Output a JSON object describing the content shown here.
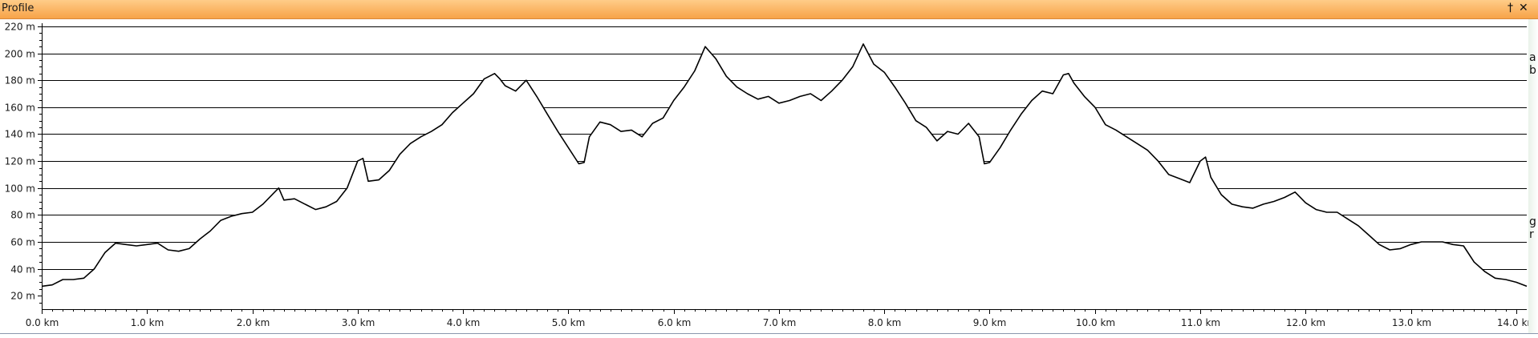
{
  "window": {
    "title": "Profile",
    "pin_icon": "pin-icon",
    "close_icon": "close-icon",
    "pin_glyph": "†",
    "close_glyph": "✕"
  },
  "right_strip_text": [
    "a",
    "b",
    "g",
    "r"
  ],
  "chart_data": {
    "type": "area",
    "xlabel": "",
    "ylabel": "",
    "xlim": [
      0,
      14.1
    ],
    "ylim": [
      10,
      220
    ],
    "grid": true,
    "x_ticks": [
      0,
      1,
      2,
      3,
      4,
      5,
      6,
      7,
      8,
      9,
      10,
      11,
      12,
      13,
      14
    ],
    "x_tick_labels": [
      "0.0 km",
      "1.0 km",
      "2.0 km",
      "3.0 km",
      "4.0 km",
      "5.0 km",
      "6.0 km",
      "7.0 km",
      "8.0 km",
      "9.0 km",
      "10.0 km",
      "11.0 km",
      "12.0 km",
      "13.0 km",
      "14.0 km"
    ],
    "y_ticks": [
      20,
      40,
      60,
      80,
      100,
      120,
      140,
      160,
      180,
      200,
      220
    ],
    "y_tick_labels": [
      "20 m",
      "40 m",
      "60 m",
      "80 m",
      "100 m",
      "120 m",
      "140 m",
      "160 m",
      "180 m",
      "200 m",
      "220 m"
    ],
    "colors": {
      "line": "#000000",
      "fill": "#ffffff",
      "grid": "#000000"
    },
    "series": [
      {
        "x": [
          0,
          0.1,
          0.2,
          0.3,
          0.4,
          0.5,
          0.6,
          0.7,
          0.8,
          0.9,
          1.0,
          1.1,
          1.2,
          1.3,
          1.4,
          1.5,
          1.6,
          1.7,
          1.8,
          1.9,
          2.0,
          2.1,
          2.2,
          2.25,
          2.3,
          2.4,
          2.5,
          2.6,
          2.7,
          2.8,
          2.9,
          3.0,
          3.05,
          3.1,
          3.2,
          3.3,
          3.4,
          3.5,
          3.6,
          3.7,
          3.8,
          3.9,
          4.0,
          4.1,
          4.2,
          4.3,
          4.35,
          4.4,
          4.5,
          4.6,
          4.7,
          4.8,
          4.9,
          5.0,
          5.1,
          5.15,
          5.2,
          5.3,
          5.4,
          5.5,
          5.6,
          5.7,
          5.8,
          5.9,
          6.0,
          6.1,
          6.2,
          6.3,
          6.4,
          6.5,
          6.6,
          6.7,
          6.8,
          6.9,
          7.0,
          7.1,
          7.2,
          7.3,
          7.4,
          7.5,
          7.6,
          7.7,
          7.8,
          7.9,
          8.0,
          8.1,
          8.2,
          8.3,
          8.4,
          8.5,
          8.6,
          8.7,
          8.8,
          8.9,
          8.95,
          9.0,
          9.1,
          9.2,
          9.3,
          9.4,
          9.5,
          9.6,
          9.7,
          9.75,
          9.8,
          9.9,
          10.0,
          10.1,
          10.2,
          10.3,
          10.4,
          10.5,
          10.6,
          10.7,
          10.8,
          10.9,
          11.0,
          11.05,
          11.1,
          11.2,
          11.3,
          11.4,
          11.5,
          11.6,
          11.7,
          11.8,
          11.9,
          12.0,
          12.1,
          12.2,
          12.3,
          12.4,
          12.5,
          12.6,
          12.7,
          12.8,
          12.9,
          13.0,
          13.1,
          13.2,
          13.3,
          13.4,
          13.5,
          13.6,
          13.7,
          13.8,
          13.9,
          14.0,
          14.1
        ],
        "y": [
          27,
          28,
          32,
          32,
          33,
          40,
          52,
          59,
          58,
          57,
          58,
          59,
          54,
          53,
          55,
          62,
          68,
          76,
          79,
          81,
          82,
          88,
          96,
          100,
          91,
          92,
          88,
          84,
          86,
          90,
          100,
          120,
          122,
          105,
          106,
          113,
          125,
          133,
          138,
          142,
          147,
          156,
          163,
          170,
          181,
          185,
          181,
          176,
          172,
          180,
          168,
          155,
          142,
          130,
          118,
          119,
          138,
          149,
          147,
          142,
          143,
          138,
          148,
          152,
          165,
          175,
          187,
          205,
          196,
          183,
          175,
          170,
          166,
          168,
          163,
          165,
          168,
          170,
          165,
          172,
          180,
          190,
          207,
          192,
          186,
          175,
          163,
          150,
          145,
          135,
          142,
          140,
          148,
          138,
          118,
          119,
          130,
          143,
          155,
          165,
          172,
          170,
          184,
          185,
          178,
          168,
          160,
          147,
          143,
          138,
          133,
          128,
          120,
          110,
          107,
          104,
          120,
          123,
          108,
          95,
          88,
          86,
          85,
          88,
          90,
          93,
          97,
          89,
          84,
          82,
          82,
          77,
          72,
          65,
          58,
          54,
          55,
          58,
          60,
          60,
          60,
          58,
          57,
          45,
          38,
          33,
          32,
          30,
          27
        ]
      }
    ]
  }
}
